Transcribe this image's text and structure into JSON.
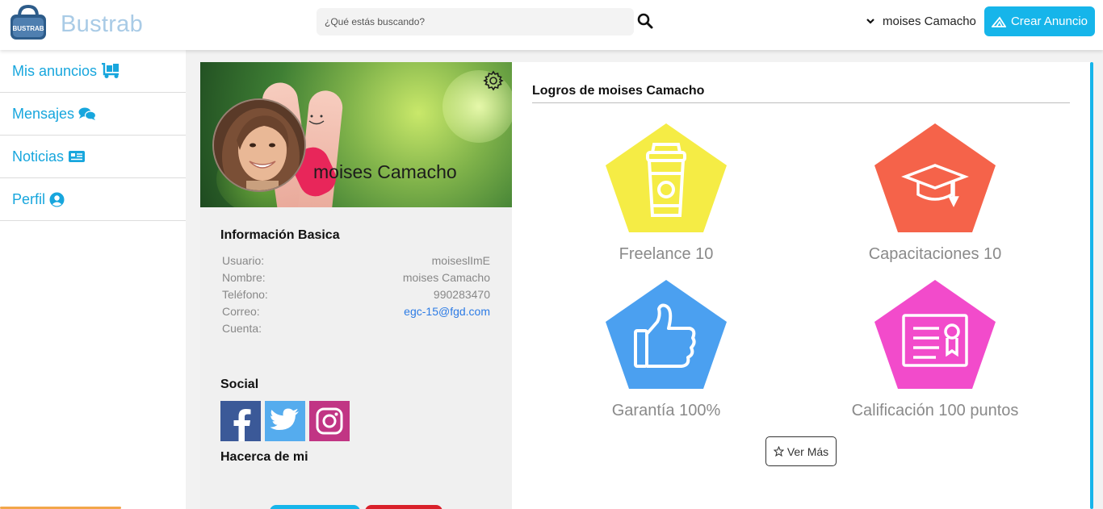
{
  "header": {
    "brand": "Bustrab",
    "logo_text": "BUSTRAB",
    "search_placeholder": "¿Qué estás buscando?",
    "user_name": "moises Camacho",
    "create_button": "Crear Anuncio"
  },
  "sidebar": {
    "items": [
      {
        "label": "Mis anuncios",
        "icon": "dolly-icon"
      },
      {
        "label": "Mensajes",
        "icon": "comments-icon"
      },
      {
        "label": "Noticias",
        "icon": "newspaper-icon"
      },
      {
        "label": "Perfil",
        "icon": "user-circle-icon"
      }
    ]
  },
  "profile": {
    "cover_name": "moises Camacho",
    "basic_title": "Información Basica",
    "fields": [
      {
        "label": "Usuario:",
        "value": "moiseslImE"
      },
      {
        "label": "Nombre:",
        "value": "moises Camacho"
      },
      {
        "label": "Teléfono:",
        "value": "990283470"
      },
      {
        "label": "Correo:",
        "value": "egc-15@fgd.com"
      },
      {
        "label": "Cuenta:",
        "value": ""
      }
    ],
    "social_title": "Social",
    "social": [
      {
        "network": "facebook-icon",
        "color": "#3b5998"
      },
      {
        "network": "twitter-icon",
        "color": "#55acee"
      },
      {
        "network": "instagram-icon",
        "color": "#c13584"
      }
    ],
    "about_title": "Hacerca de mi"
  },
  "achievements": {
    "title": "Logros de moises Camacho",
    "badges": [
      {
        "label": "Freelance 10",
        "color": "#f5ec45",
        "icon": "coffee-cup-icon"
      },
      {
        "label": "Capacitaciones 10",
        "color": "#f5634a",
        "icon": "graduation-cap-icon"
      },
      {
        "label": "Garantía 100%",
        "color": "#4ba0f0",
        "icon": "thumbs-up-icon"
      },
      {
        "label": "Calificación 100 puntos",
        "color": "#f24bcb",
        "icon": "certificate-icon"
      }
    ],
    "more_button": "Ver Más"
  },
  "colors": {
    "accent": "#16b5ea",
    "sidebar_text": "#17a6dd",
    "brand_text": "#a9cbe6"
  }
}
